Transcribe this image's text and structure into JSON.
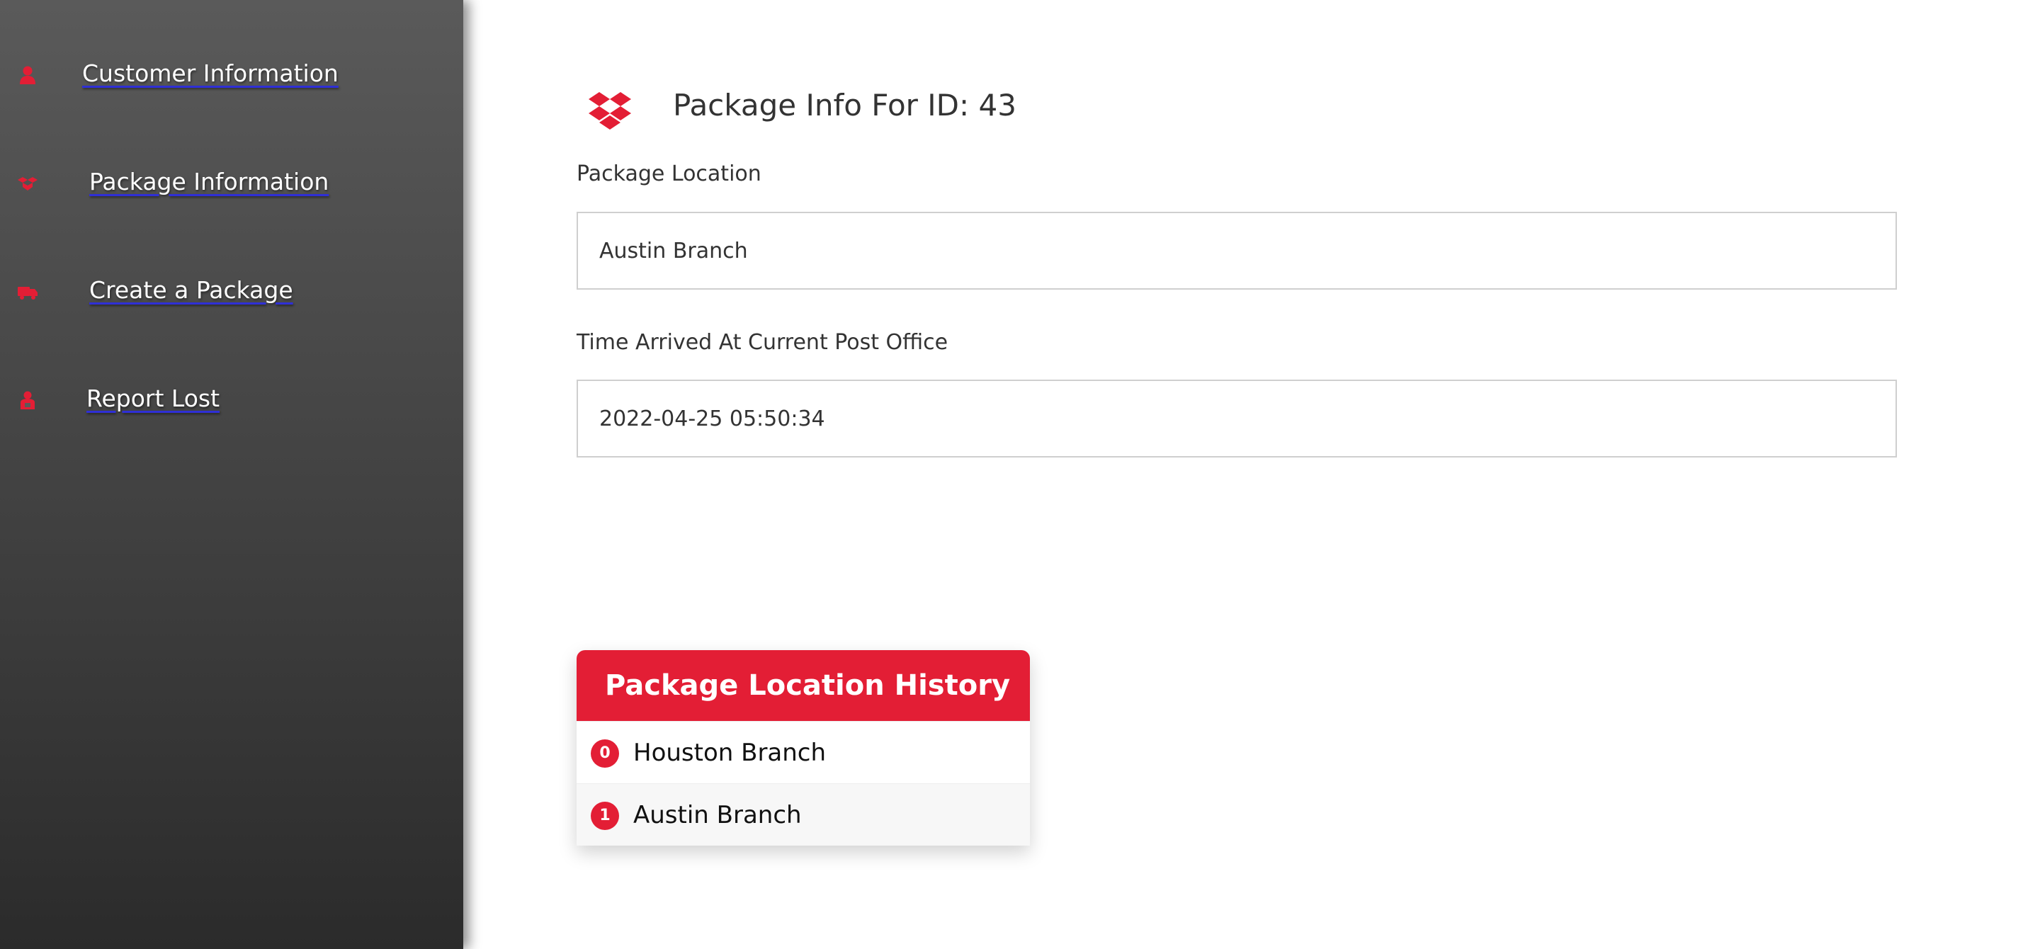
{
  "sidebar": {
    "items": [
      {
        "label": "Customer Information",
        "icon": "user-icon"
      },
      {
        "label": "Package Information",
        "icon": "box-icon"
      },
      {
        "label": "Create a Package",
        "icon": "truck-icon"
      },
      {
        "label": "Report Lost",
        "icon": "lost-person-icon"
      }
    ]
  },
  "header": {
    "title": "Package Info For ID: 43",
    "logo_icon": "package-box-icon"
  },
  "form": {
    "location_label": "Package Location",
    "location_value": "Austin Branch",
    "time_label": "Time Arrived At Current Post Office",
    "time_value": "2022-04-25 05:50:34"
  },
  "history": {
    "title": "Package Location History",
    "rows": [
      {
        "index": "0",
        "name": "Houston Branch"
      },
      {
        "index": "1",
        "name": "Austin Branch"
      }
    ]
  },
  "colors": {
    "accent": "#e31e35",
    "sidebar_top": "#5a5a5a",
    "sidebar_bottom": "#2b2b2b",
    "link_underline": "#2f2fd6"
  }
}
